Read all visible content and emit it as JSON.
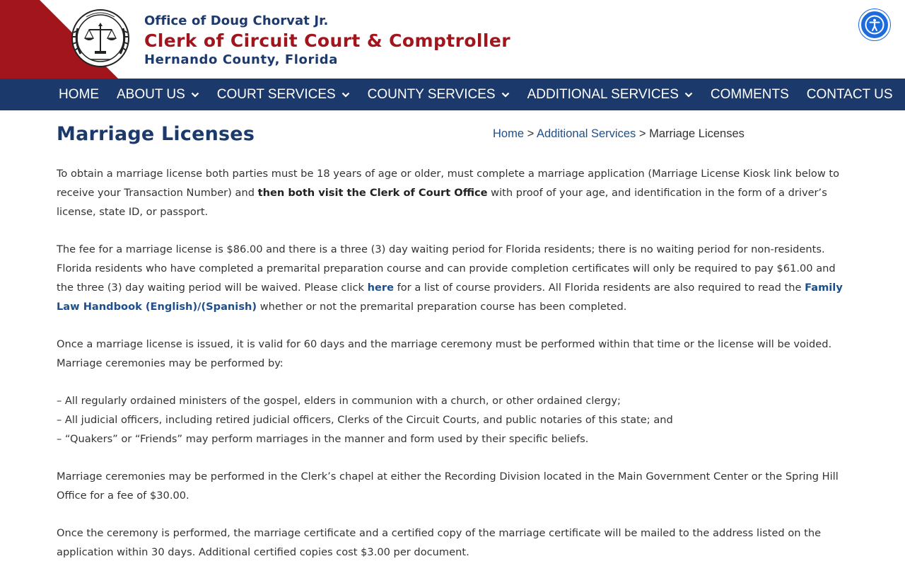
{
  "header": {
    "office": "Office of Doug Chorvat Jr.",
    "clerk": "Clerk of Circuit Court & Comptroller",
    "county": "Hernando County, Florida",
    "accent_red": "#a3151d",
    "accent_navy": "#1b3a6b",
    "seal_icon": "clerk-seal-logo",
    "accessibility_icon": "accessibility-icon"
  },
  "nav": {
    "home": "HOME",
    "about": "ABOUT US",
    "court": "COURT SERVICES",
    "county": "COUNTY SERVICES",
    "additional": "ADDITIONAL SERVICES",
    "comments": "COMMENTS",
    "contact": "CONTACT US"
  },
  "page": {
    "title": "Marriage Licenses"
  },
  "breadcrumb": {
    "home": "Home",
    "sep1": ">",
    "additional": "Additional Services",
    "sep2": ">",
    "current": "Marriage Licenses"
  },
  "content": {
    "p1_a": "To obtain a marriage license both parties must be 18 years of age or older, must complete a marriage application (Marriage License Kiosk link below to receive your Transaction Number) and ",
    "p1_bold": "then both visit the Clerk of Court Office",
    "p1_b": " with proof of your age, and identification in the form of a driver’s license, state ID, or passport.",
    "p2_a": "The fee for a marriage license is $86.00 and there is a three (3) day waiting period for Florida residents; there is no waiting period for non-residents.  Florida residents who have completed a premarital preparation course and can provide completion certificates will only be required to pay $61.00 and the three (3) day waiting period will be waived.  Please click ",
    "p2_link_here": "here",
    "p2_b": " for a list of course providers.  All Florida residents are also required to read the ",
    "p2_link_handbook": "Family Law Handbook (English)/(Spanish)",
    "p2_c": " whether or not the premarital preparation course has been completed.",
    "p3": "Once a marriage license is issued, it is valid for 60 days and the marriage ceremony must be performed within that time or the license will be voided. Marriage ceremonies may be performed by:",
    "list": [
      "– All regularly ordained ministers of the gospel, elders in communion with a church, or other ordained clergy;",
      "– All judicial officers, including retired judicial officers, Clerks of the Circuit Courts, and public notaries of this state; and",
      "– “Quakers” or “Friends” may perform marriages in the manner and form used by their specific beliefs."
    ],
    "p4": "Marriage ceremonies may be performed in the Clerk’s chapel at either the Recording Division located in the Main Government Center or the Spring Hill Office for a fee of $30.00.",
    "p5": "Once the ceremony is performed, the marriage certificate and a certified copy of the marriage certificate will be mailed to the address listed on the application within 30 days.  Additional certified copies cost $3.00 per document."
  }
}
